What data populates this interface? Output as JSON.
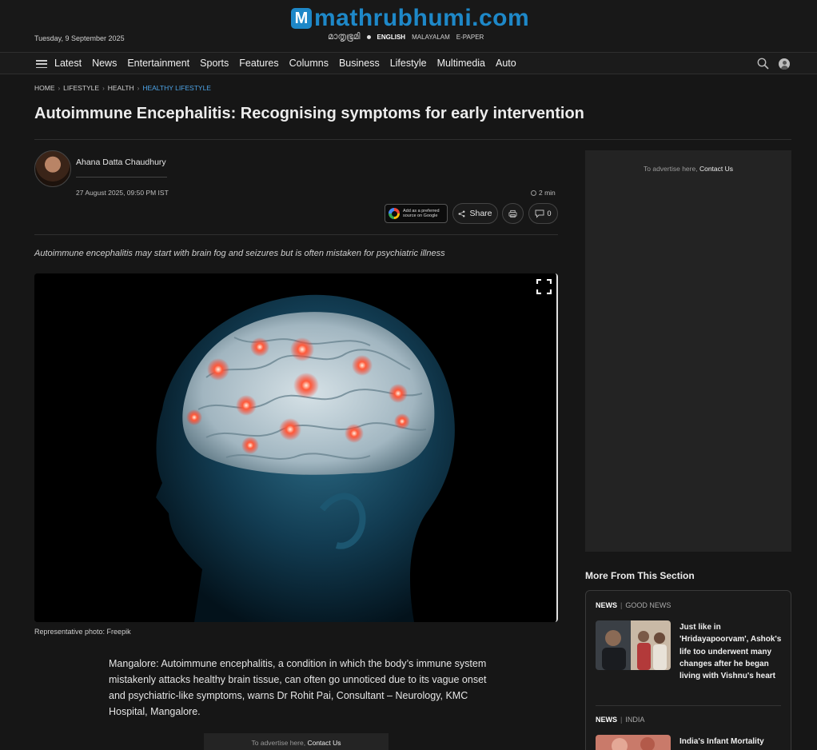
{
  "header": {
    "date": "Tuesday, 9 September 2025",
    "logo_letter": "M",
    "logo_text": "mathrubhumi.com",
    "logo_malayalam": "മാതൃഭൂമി",
    "language_english": "ENGLISH",
    "language_malayalam": "MALAYALAM",
    "epaper": "E-PAPER"
  },
  "nav": {
    "items": [
      "Latest",
      "News",
      "Entertainment",
      "Sports",
      "Features",
      "Columns",
      "Business",
      "Lifestyle",
      "Multimedia",
      "Auto"
    ]
  },
  "breadcrumb": [
    "HOME",
    "LIFESTYLE",
    "HEALTH",
    "HEALTHY LIFESTYLE"
  ],
  "article": {
    "title": "Autoimmune Encephalitis: Recognising symptoms for early intervention",
    "author": "Ahana Datta Chaudhury",
    "published": "27 August 2025, 09:50 PM IST",
    "read_time": "2 min",
    "google_badge_line1": "Add as a preferred",
    "google_badge_line2": "source on Google",
    "share_label": "Share",
    "comment_count": "0",
    "summary": "Autoimmune encephalitis may start with brain fog and seizures but is often mistaken for psychiatric illness",
    "image_caption": "Representative photo: Freepik",
    "body_paragraph": "Mangalore: Autoimmune encephalitis, a condition in which the body’s immune system mistakenly attacks healthy brain tissue, can often go unnoticed due to its vague onset and psychiatric-like symptoms, warns Dr Rohit Pai, Consultant – Neurology, KMC Hospital, Mangalore."
  },
  "ads": {
    "text": "To advertise here,",
    "link": "Contact Us"
  },
  "sidebar": {
    "section_title": "More From This Section",
    "stories": [
      {
        "category": "NEWS",
        "subcategory": "GOOD NEWS",
        "title": "Just like in 'Hridayapoorvam', Ashok's life too underwent many changes after he began living with Vishnu's heart"
      },
      {
        "category": "NEWS",
        "subcategory": "INDIA",
        "title": "India's Infant Mortality"
      }
    ]
  }
}
